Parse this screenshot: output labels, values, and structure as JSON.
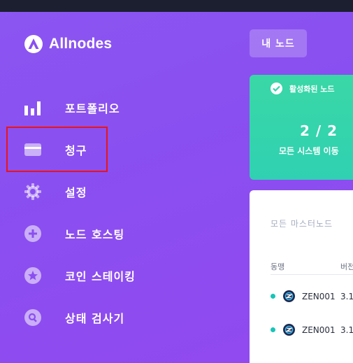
{
  "brand": {
    "name": "Allnodes",
    "logo_icon": "allnodes-logo-icon"
  },
  "sidebar": {
    "items": [
      {
        "label": "포트폴리오",
        "icon": "bar-chart-icon"
      },
      {
        "label": "청구",
        "icon": "credit-card-icon",
        "highlighted": true
      },
      {
        "label": "설정",
        "icon": "gear-icon"
      },
      {
        "label": "노드 호스팅",
        "icon": "plus-circle-icon"
      },
      {
        "label": "코인 스테이킹",
        "icon": "star-circle-icon"
      },
      {
        "label": "상태 검사기",
        "icon": "search-circle-icon"
      }
    ]
  },
  "header": {
    "my_nodes_button": "내 노드"
  },
  "active_card": {
    "title": "활성화된 노드",
    "count": "2 / 2",
    "subtitle": "모든 시스템 이동"
  },
  "nodes_card": {
    "title": "모든 마스터노드",
    "columns": [
      "동맹",
      "버전"
    ],
    "rows": [
      {
        "name": "ZEN001",
        "version": "3.1"
      },
      {
        "name": "ZEN001",
        "version": "3.1"
      }
    ]
  },
  "colors": {
    "sidebar_bg": "#8a4ff0",
    "active_card": "#34d4ac",
    "highlight_border": "#e8141b",
    "status_dot": "#18c4b8"
  }
}
